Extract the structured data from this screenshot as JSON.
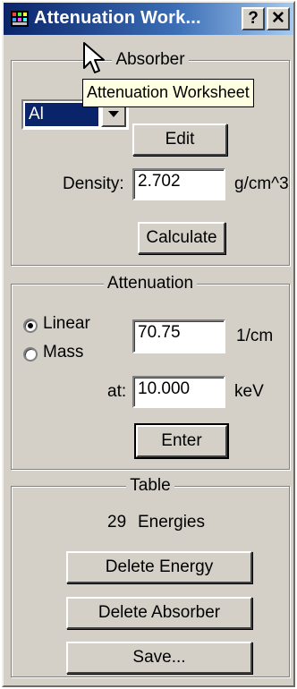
{
  "window": {
    "title": "Attenuation Work...",
    "help_button": "?",
    "close_button": "✕"
  },
  "absorber": {
    "legend": "Absorber",
    "material": "Al",
    "edit_label": "Edit",
    "density_label": "Density:",
    "density_value": "2.702",
    "density_unit": "g/cm^3",
    "calculate_label": "Calculate"
  },
  "tooltip": {
    "text": "Attenuation Worksheet"
  },
  "attenuation": {
    "legend": "Attenuation",
    "linear_label": "Linear",
    "mass_label": "Mass",
    "selected": "Linear",
    "value": "70.75",
    "unit": "1/cm",
    "at_label": "at:",
    "energy_value": "10.000",
    "energy_unit": "keV",
    "enter_label": "Enter"
  },
  "table": {
    "legend": "Table",
    "energy_count": "29",
    "energies_label": "Energies",
    "delete_energy_label": "Delete Energy",
    "delete_absorber_label": "Delete Absorber",
    "save_label": "Save..."
  }
}
